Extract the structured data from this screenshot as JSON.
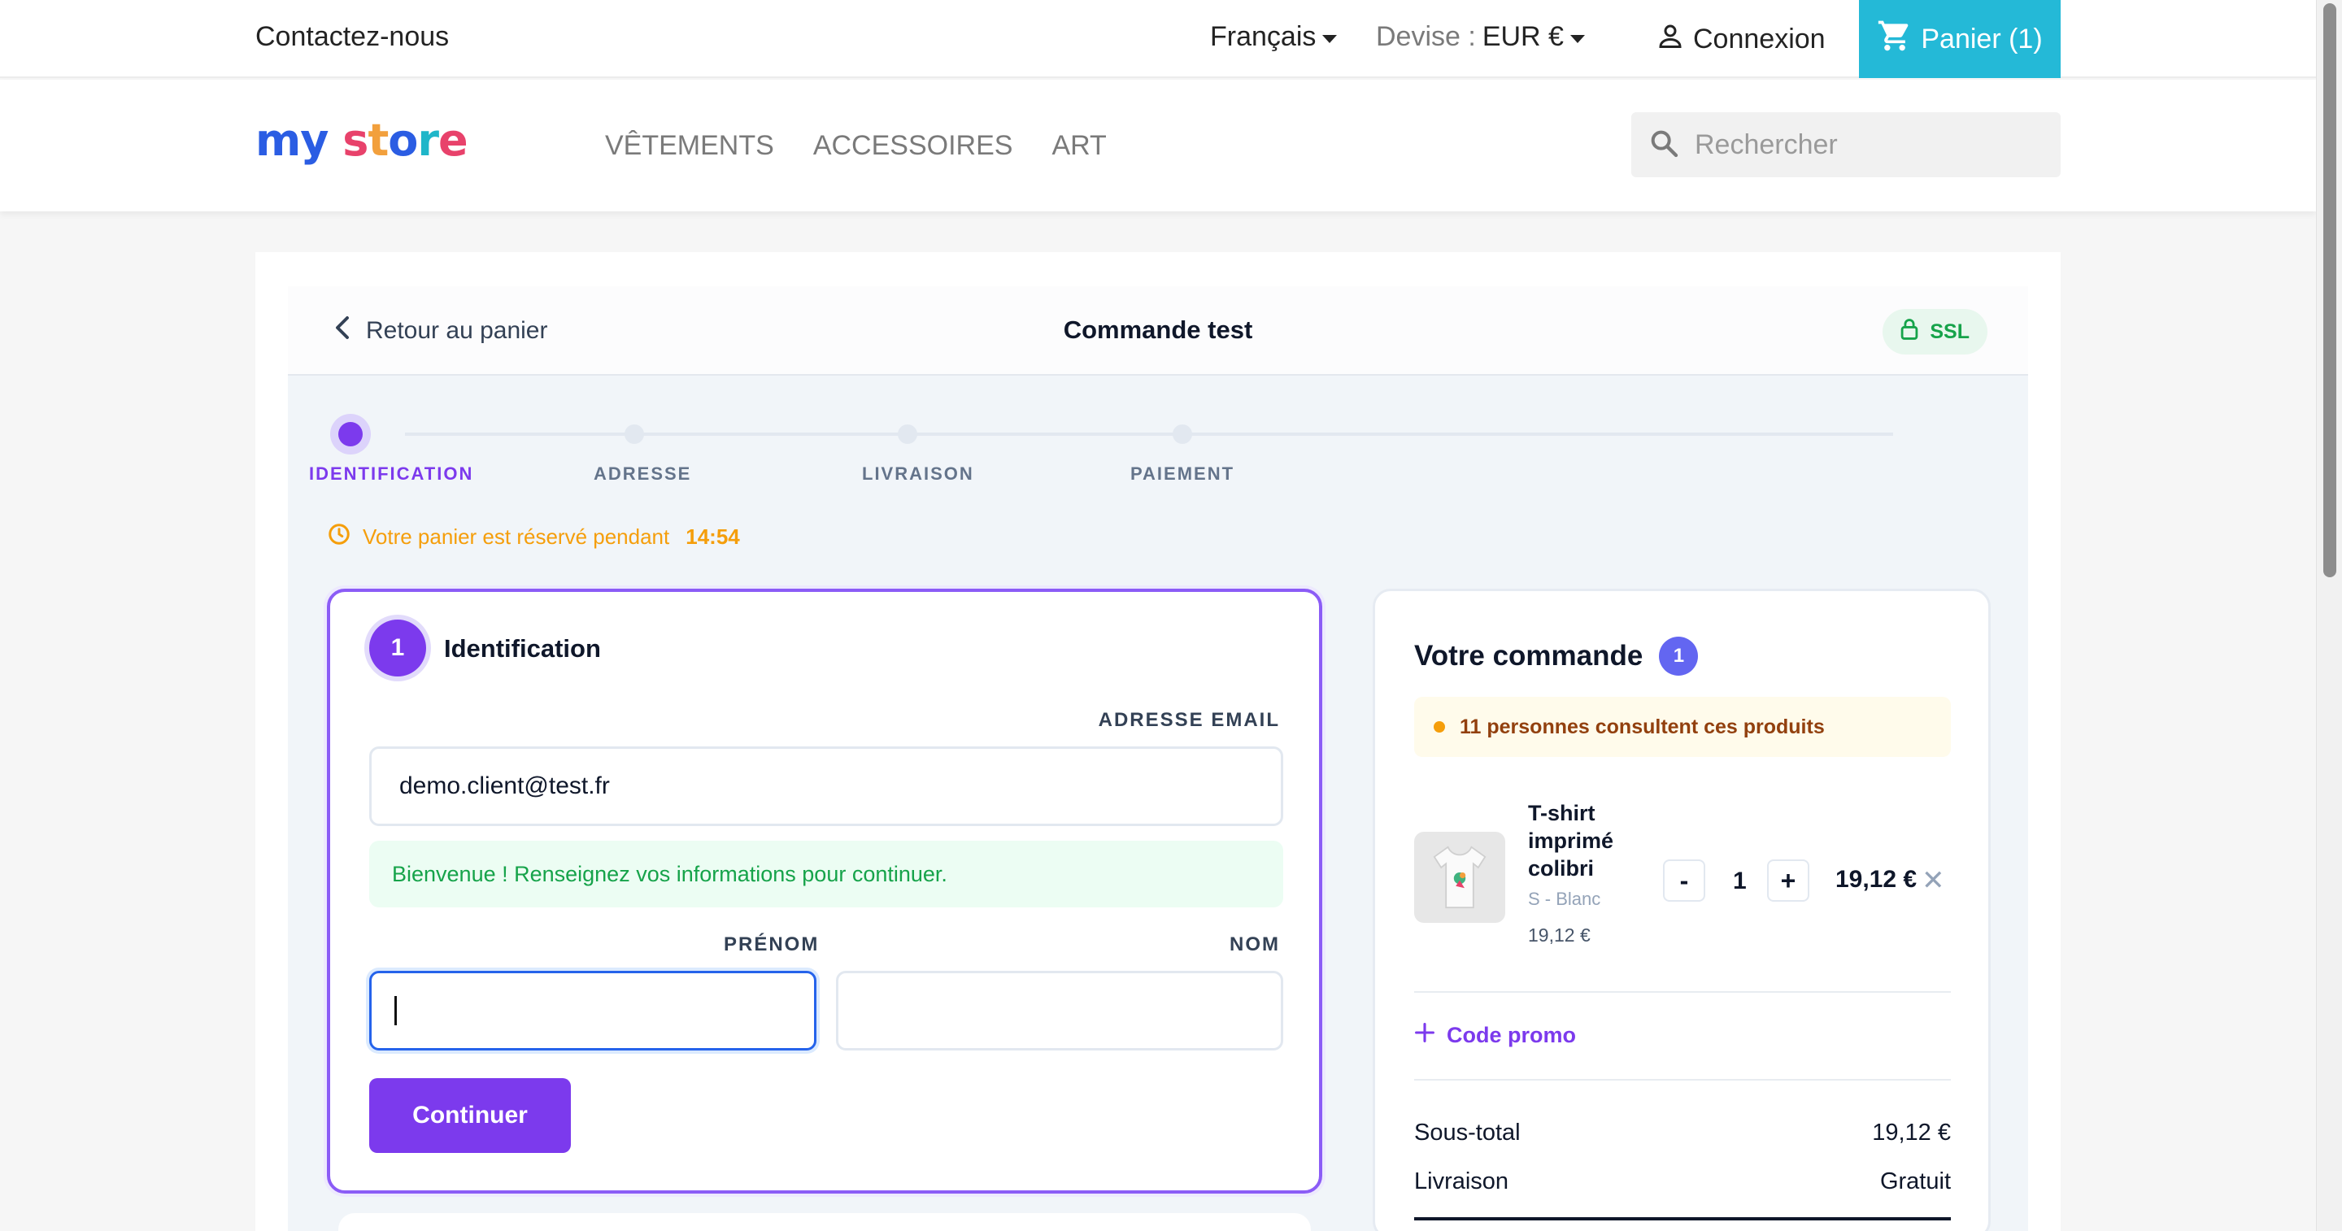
{
  "topbar": {
    "contact": "Contactez-nous",
    "language": "Français",
    "currency_label": "Devise :",
    "currency_value": "EUR €",
    "login": "Connexion",
    "cart": "Panier (1)"
  },
  "header": {
    "logo_parts": [
      "my",
      " ",
      "s",
      "t",
      "o",
      "r",
      "e"
    ],
    "nav": [
      "VÊTEMENTS",
      "ACCESSOIRES",
      "ART"
    ],
    "search_placeholder": "Rechercher"
  },
  "checkout": {
    "back": "Retour au panier",
    "title": "Commande test",
    "ssl": "SSL",
    "steps": [
      "IDENTIFICATION",
      "ADRESSE",
      "LIVRAISON",
      "PAIEMENT"
    ],
    "active_step": 0,
    "timer_text": "Votre panier est réservé pendant",
    "timer_value": "14:54"
  },
  "identification": {
    "number": "1",
    "title": "Identification",
    "email_label": "ADRESSE EMAIL",
    "email_value": "demo.client@test.fr",
    "welcome": "Bienvenue ! Renseignez vos informations pour continuer.",
    "firstname_label": "PRÉNOM",
    "firstname_value": "",
    "lastname_label": "NOM",
    "lastname_value": "",
    "submit": "Continuer"
  },
  "order": {
    "title": "Votre commande",
    "count": "1",
    "viewers": "11 personnes consultent ces produits",
    "product": {
      "name": "T-shirt imprimé colibri",
      "variant": "S - Blanc",
      "unit_price": "19,12 €",
      "qty_minus": "-",
      "qty": "1",
      "qty_plus": "+",
      "line_total": "19,12 €",
      "remove": "✕"
    },
    "promo": "Code promo",
    "subtotal_label": "Sous-total",
    "subtotal_value": "19,12 €",
    "shipping_label": "Livraison",
    "shipping_value": "Gratuit"
  },
  "colors": {
    "accent": "#7c3aed",
    "cart_bg": "#24b9d7",
    "success": "#16a34a",
    "warning": "#f59e0b"
  },
  "icons": [
    "caret-down-icon",
    "user-icon",
    "cart-icon",
    "search-icon",
    "chevron-left-icon",
    "lock-icon",
    "clock-icon",
    "plus-icon",
    "close-icon",
    "tshirt-icon"
  ]
}
